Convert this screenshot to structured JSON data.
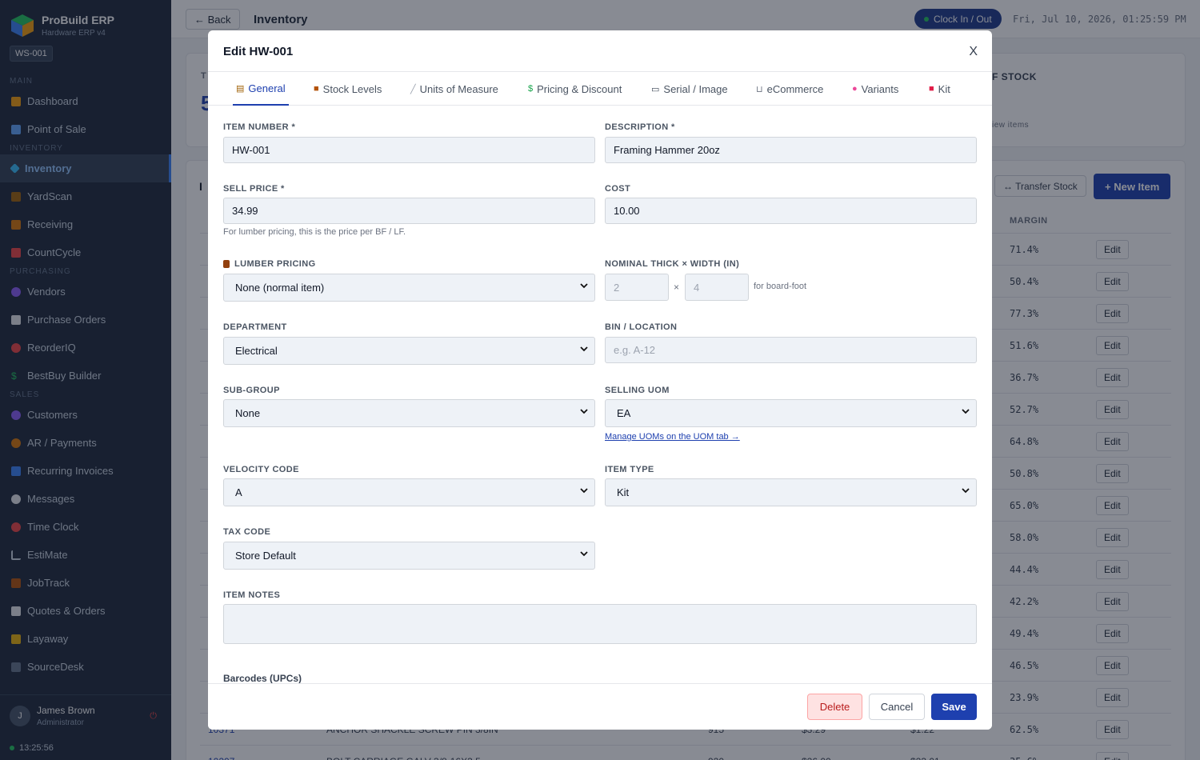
{
  "sidebar": {
    "brand_name": "ProBuild ERP",
    "brand_sub": "Hardware ERP v4",
    "workstation": "WS-001",
    "sections": {
      "main": "MAIN",
      "inventory": "INVENTORY",
      "purchasing": "PURCHASING",
      "sales": "SALES"
    },
    "items": {
      "dashboard": "Dashboard",
      "pos": "Point of Sale",
      "inventory": "Inventory",
      "yardscan": "YardScan",
      "receiving": "Receiving",
      "countcycle": "CountCycle",
      "vendors": "Vendors",
      "purchase_orders": "Purchase Orders",
      "reorderiq": "ReorderIQ",
      "bestbuy": "BestBuy Builder",
      "customers": "Customers",
      "ar": "AR / Payments",
      "recurring": "Recurring Invoices",
      "messages": "Messages",
      "timeclock": "Time Clock",
      "estimate": "EstiMate",
      "jobtrack": "JobTrack",
      "quotes": "Quotes & Orders",
      "layaway": "Layaway",
      "sourcedesk": "SourceDesk"
    },
    "user": {
      "initial": "J",
      "name": "James Brown",
      "role": "Administrator"
    },
    "clock": "13:25:56"
  },
  "topbar": {
    "back_label": "← Back",
    "title": "Inventory",
    "clock_label": "Clock In / Out",
    "datetime": "Fri, Jul 10, 2026, 01:25:59 PM"
  },
  "background": {
    "stat_prefix": "T",
    "stat_value_prefix": "5",
    "stat_right_label": "F STOCK",
    "stat_right_sub": "iew items",
    "list_prefix": "I",
    "transfer_label": "↔ Transfer Stock",
    "new_item_label": "+ New Item",
    "margin_header": "MARGIN",
    "edit_label": "Edit",
    "margins": [
      "71.4%",
      "50.4%",
      "77.3%",
      "51.6%",
      "36.7%",
      "52.7%",
      "64.8%",
      "50.8%",
      "65.0%",
      "58.0%",
      "44.4%",
      "42.2%",
      "49.4%",
      "46.5%",
      "23.9%",
      "62.5%",
      "35.6%"
    ],
    "row_peek": {
      "item": "10371",
      "desc": "ANCHOR SHACKLE SCREW PIN 3/8IN",
      "qty": "915",
      "price": "$3.29",
      "cost": "$1.22"
    },
    "row_peek2": {
      "item": "10207",
      "desc": "BOLT CARRIAGE GALV 3/8-16X3.5",
      "qty": "920",
      "price": "$26.00",
      "cost": "$23.01"
    }
  },
  "modal": {
    "title": "Edit HW-001",
    "close_label": "X",
    "tabs": [
      {
        "label": "General",
        "icon": "clipboard-icon"
      },
      {
        "label": "Stock Levels",
        "icon": "box-icon"
      },
      {
        "label": "Units of Measure",
        "icon": "ruler-icon"
      },
      {
        "label": "Pricing & Discount",
        "icon": "dollar-icon"
      },
      {
        "label": "Serial / Image",
        "icon": "camera-icon"
      },
      {
        "label": "eCommerce",
        "icon": "cart-icon"
      },
      {
        "label": "Variants",
        "icon": "palette-icon"
      },
      {
        "label": "Kit",
        "icon": "toolbox-icon"
      }
    ],
    "fields": {
      "item_number_label": "ITEM NUMBER *",
      "item_number": "HW-001",
      "description_label": "DESCRIPTION *",
      "description": "Framing Hammer 20oz",
      "sell_price_label": "SELL PRICE *",
      "sell_price": "34.99",
      "sell_price_hint": "For lumber pricing, this is the price per BF / LF.",
      "cost_label": "COST",
      "cost": "10.00",
      "lumber_label": "LUMBER PRICING",
      "lumber": "None (normal item)",
      "nominal_label": "NOMINAL THICK × WIDTH (IN)",
      "thick_placeholder": "2",
      "width_placeholder": "4",
      "times": "×",
      "nominal_hint": "for board-foot",
      "department_label": "DEPARTMENT",
      "department": "Electrical",
      "bin_label": "BIN / LOCATION",
      "bin_placeholder": "e.g. A-12",
      "subgroup_label": "SUB-GROUP",
      "subgroup": "None",
      "selling_uom_label": "SELLING UOM",
      "selling_uom": "EA",
      "uom_link": "Manage UOMs on the UOM tab →",
      "velocity_label": "VELOCITY CODE",
      "velocity": "A",
      "item_type_label": "ITEM TYPE",
      "item_type": "Kit",
      "tax_label": "TAX CODE",
      "tax": "Store Default",
      "notes_label": "ITEM NOTES",
      "barcodes_label": "Barcodes (UPCs)"
    },
    "footer": {
      "delete": "Delete",
      "cancel": "Cancel",
      "save": "Save"
    }
  }
}
